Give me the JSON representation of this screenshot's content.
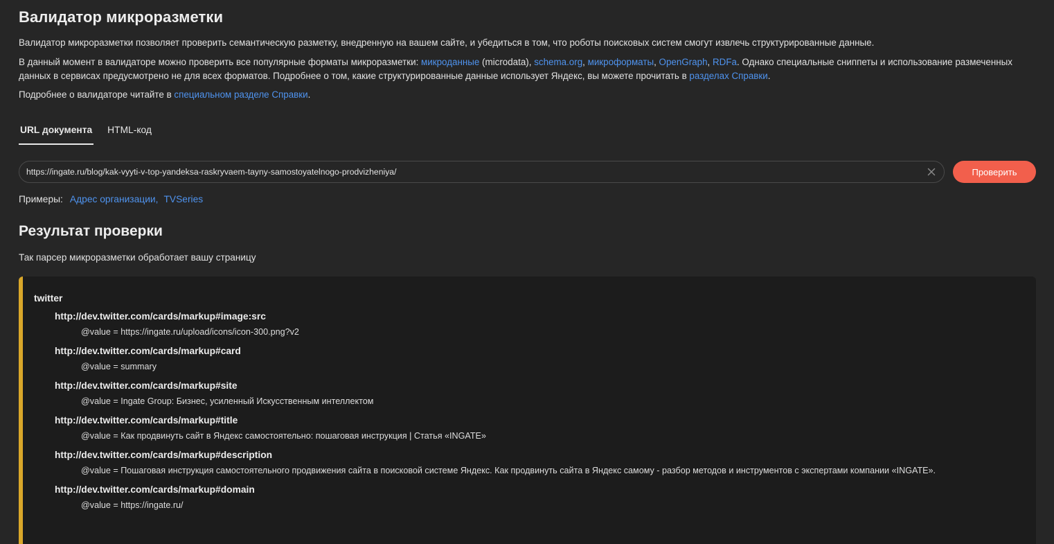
{
  "header": {
    "title": "Валидатор микроразметки"
  },
  "intro": {
    "p1": "Валидатор микроразметки позволяет проверить семантическую разметку, внедренную на вашем сайте, и убедиться в том, что роботы поисковых систем смогут извлечь структурированные данные.",
    "p2_part1": "В данный момент в валидаторе можно проверить все популярные форматы микроразметки: ",
    "link_microdata": "микроданные",
    "p2_part2": " (microdata), ",
    "link_schema": "schema.org",
    "comma1": ", ",
    "link_microformats": "микроформаты",
    "comma2": ", ",
    "link_opengraph": "OpenGraph",
    "comma3": ", ",
    "link_rdfa": "RDFa",
    "p2_part3": ". Однако специальные сниппеты и использование размеченных данных в сервисах предусмотрено не для всех форматов. Подробнее о том, какие структурированные данные использует Яндекс, вы можете прочитать в ",
    "link_help_sections": "разделах Справки",
    "p2_end": ".",
    "p3_part1": "Подробнее о валидаторе читайте в ",
    "link_special_section": "специальном разделе Справки",
    "p3_end": "."
  },
  "tabs": {
    "url": "URL документа",
    "html": "HTML-код"
  },
  "url_input": {
    "value": "https://ingate.ru/blog/kak-vyyti-v-top-yandeksa-raskryvaem-tayny-samostoyatelnogo-prodvizheniya/",
    "icon": "close-icon"
  },
  "check_button": "Проверить",
  "examples": {
    "label": "Примеры:",
    "items": [
      "Адрес организации,",
      "TVSeries"
    ]
  },
  "result": {
    "title": "Результат проверки",
    "subtitle": "Так парсер микроразметки обработает вашу страницу",
    "root": "twitter",
    "props": [
      {
        "name": "http://dev.twitter.com/cards/markup#image:src",
        "value": "@value = https://ingate.ru/upload/icons/icon-300.png?v2"
      },
      {
        "name": "http://dev.twitter.com/cards/markup#card",
        "value": "@value = summary"
      },
      {
        "name": "http://dev.twitter.com/cards/markup#site",
        "value": "@value = Ingate Group: Бизнес, усиленный Искусственным интеллектом"
      },
      {
        "name": "http://dev.twitter.com/cards/markup#title",
        "value": "@value = Как продвинуть сайт в Яндекс самостоятельно: пошаговая инструкция | Статья «INGATE»"
      },
      {
        "name": "http://dev.twitter.com/cards/markup#description",
        "value": "@value = Пошаговая инструкция самостоятельного продвижения сайта в поисковой системе Яндекс. Как продвинуть сайта в Яндекс самому - разбор методов и инструментов с экспертами компании «INGATE»."
      },
      {
        "name": "http://dev.twitter.com/cards/markup#domain",
        "value": "@value = https://ingate.ru/"
      }
    ]
  },
  "colors": {
    "background": "#262626",
    "accent_button": "#f25f4c",
    "link": "#4f93ee",
    "result_border": "#d9a72a",
    "result_bg": "#1c1c1c"
  }
}
